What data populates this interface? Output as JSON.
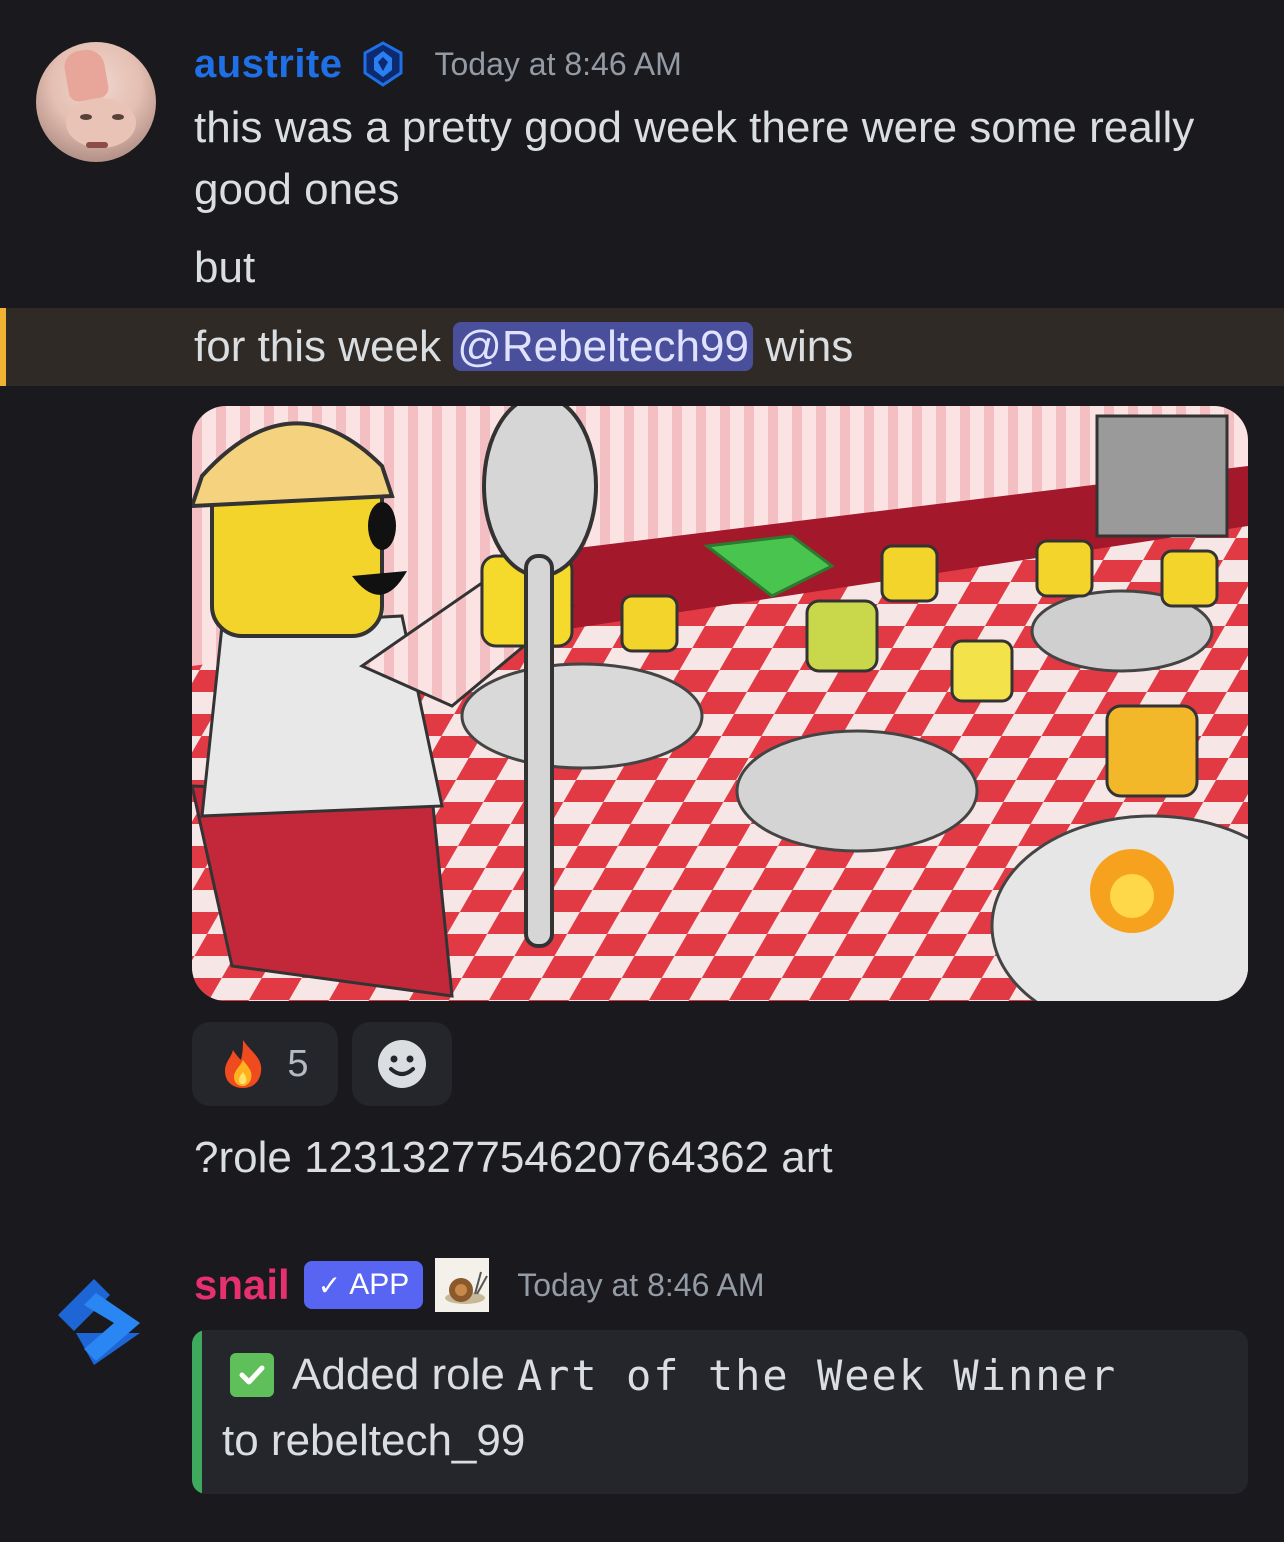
{
  "messages": [
    {
      "author": "austrite",
      "timestamp": "Today at 8:46 AM",
      "lines": {
        "line1a": "this was a pretty good week there were some really",
        "line1b": "good ones",
        "line2": "but",
        "line3_prefix": "for this week ",
        "line3_mention": "@Rebeltech99",
        "line3_suffix": " wins"
      },
      "reactions": [
        {
          "emoji": "fire",
          "count": "5"
        }
      ],
      "followup": "?role 1231327754620764362 art"
    },
    {
      "author": "snail",
      "badge": "APP",
      "timestamp": "Today at 8:46 AM",
      "embed": {
        "prefix": "Added role",
        "role": "Art of the Week Winner",
        "suffix": "to rebeltech_99"
      }
    }
  ],
  "colors": {
    "background": "#1a1a1e",
    "austrite_name": "#1f6fe6",
    "snail_name": "#e8306f",
    "mention_bg": "#4a4f9c",
    "highlight_bar": "#f0b232",
    "embed_bar": "#3fa95e",
    "app_badge": "#5865f2"
  },
  "icons": [
    "server-badge-icon",
    "fire-emoji-icon",
    "add-reaction-icon",
    "check-icon",
    "snail-icon",
    "bot-avatar-icon"
  ]
}
